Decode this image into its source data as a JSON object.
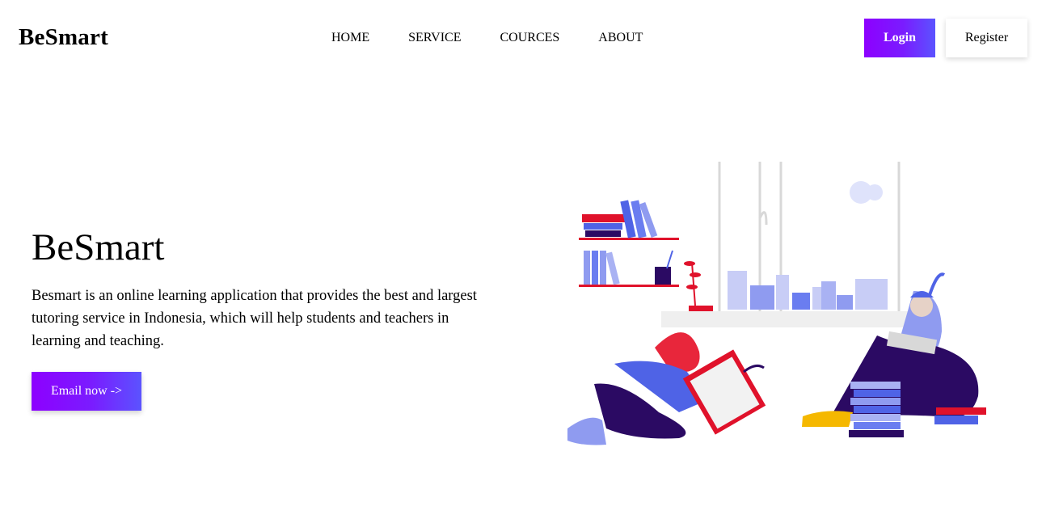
{
  "navbar": {
    "brand": "BeSmart",
    "links": [
      "HOME",
      "SERVICE",
      "COURCES",
      "ABOUT"
    ],
    "login_label": "Login",
    "register_label": "Register"
  },
  "hero": {
    "title": "BeSmart",
    "description": "Besmart is an online learning application that provides the best and largest tutoring service in Indonesia, which will help students and teachers in learning and teaching.",
    "cta_label": "Email now ->"
  },
  "colors": {
    "accent_start": "#8d00ff",
    "accent_end": "#5b53ff",
    "illustration_red": "#e0122b",
    "illustration_blue": "#4f63e6",
    "illustration_purple": "#2b0a63"
  },
  "illustration": {
    "icon": "students-studying-illustration"
  }
}
